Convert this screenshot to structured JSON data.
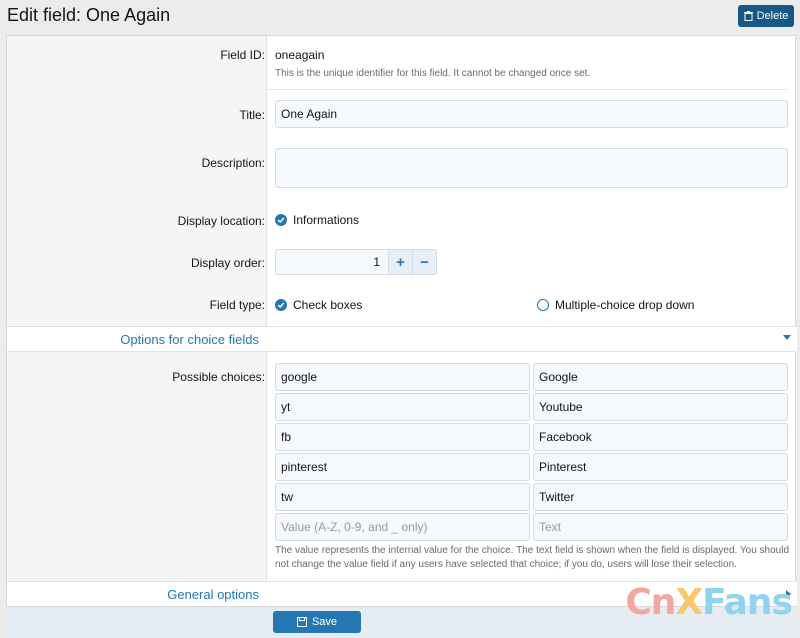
{
  "header": {
    "title": "Edit field: One Again",
    "delete_label": "Delete"
  },
  "field_id": {
    "label": "Field ID:",
    "value": "oneagain",
    "hint": "This is the unique identifier for this field. It cannot be changed once set."
  },
  "title_field": {
    "label": "Title:",
    "value": "One Again"
  },
  "description_field": {
    "label": "Description:",
    "value": ""
  },
  "display_location": {
    "label": "Display location:",
    "option": "Informations"
  },
  "display_order": {
    "label": "Display order:",
    "value": "1",
    "plus": "+",
    "minus": "−"
  },
  "field_type": {
    "label": "Field type:",
    "options": [
      {
        "label": "Check boxes",
        "selected": true
      },
      {
        "label": "Multiple-choice drop down",
        "selected": false
      }
    ]
  },
  "choice_section": {
    "title": "Options for choice fields"
  },
  "possible_choices": {
    "label": "Possible choices:",
    "rows": [
      {
        "value": "google",
        "text": "Google"
      },
      {
        "value": "yt",
        "text": "Youtube"
      },
      {
        "value": "fb",
        "text": "Facebook"
      },
      {
        "value": "pinterest",
        "text": "Pinterest"
      },
      {
        "value": "tw",
        "text": "Twitter"
      }
    ],
    "value_placeholder": "Value (A-Z, 0-9, and _ only)",
    "text_placeholder": "Text",
    "hint": "The value represents the internal value for the choice. The text field is shown when the field is displayed. You should not change the value field if any users have selected that choice; if you do, users will lose their selection."
  },
  "general_section": {
    "title": "General options"
  },
  "footer": {
    "save_label": "Save"
  },
  "watermark": {
    "part1": "Cn",
    "part2": "X",
    "part3": "Fans"
  },
  "colors": {
    "accent": "#2577b1",
    "delete_button": "#185886"
  }
}
